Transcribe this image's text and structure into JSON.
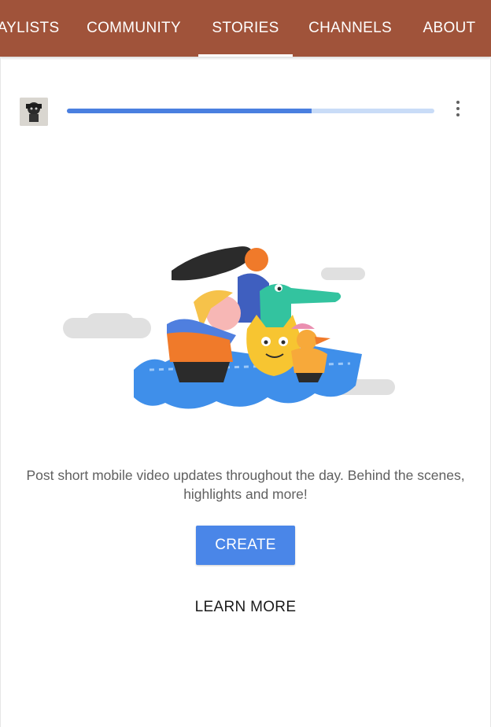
{
  "tabs": [
    {
      "label": "AYLISTS",
      "active": false
    },
    {
      "label": "COMMUNITY",
      "active": false
    },
    {
      "label": "STORIES",
      "active": true
    },
    {
      "label": "CHANNELS",
      "active": false
    },
    {
      "label": "ABOUT",
      "active": false
    }
  ],
  "colors": {
    "tab_bar": "#a0533a",
    "progress_fill": "#4a7fe0",
    "progress_track": "#c9dcf7",
    "create_button": "#4a86e8"
  },
  "story": {
    "progress_fraction": 0.667,
    "menu_icon": "more-vert-icon"
  },
  "empty_state": {
    "description": "Post short mobile video updates throughout the day. Behind the scenes, highlights and more!",
    "create_label": "CREATE",
    "learn_more_label": "LEARN MORE"
  }
}
